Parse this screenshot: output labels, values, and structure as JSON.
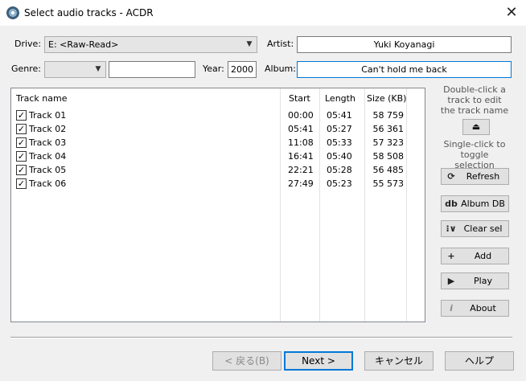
{
  "window": {
    "title": "Select audio tracks - ACDR",
    "close_glyph": "✕"
  },
  "form": {
    "drive_label": "Drive:",
    "drive_value": "E: <Raw-Read>",
    "artist_label": "Artist:",
    "artist_value": "Yuki Koyanagi",
    "genre_label": "Genre:",
    "genre_value": "",
    "genre_text": "",
    "year_label": "Year:",
    "year_value": "2000",
    "album_label": "Album:",
    "album_value": "Can't hold me back"
  },
  "tracks": {
    "columns": [
      "Track name",
      "Start",
      "Length",
      "Size (KB)"
    ],
    "rows": [
      {
        "checked": true,
        "name": "Track 01",
        "start": "00:00",
        "length": "05:41",
        "size": "58 759"
      },
      {
        "checked": true,
        "name": "Track 02",
        "start": "05:41",
        "length": "05:27",
        "size": "56 361"
      },
      {
        "checked": true,
        "name": "Track 03",
        "start": "11:08",
        "length": "05:33",
        "size": "57 323"
      },
      {
        "checked": true,
        "name": "Track 04",
        "start": "16:41",
        "length": "05:40",
        "size": "58 508"
      },
      {
        "checked": true,
        "name": "Track 05",
        "start": "22:21",
        "length": "05:28",
        "size": "56 485"
      },
      {
        "checked": true,
        "name": "Track 06",
        "start": "27:49",
        "length": "05:23",
        "size": "55 573"
      }
    ]
  },
  "side": {
    "hint_edit": "Double-click a track to edit the track name",
    "eject_glyph": "⏏",
    "hint_toggle": "Single-click to toggle selection",
    "refresh_icon": "⟳",
    "refresh": "Refresh",
    "albumdb_icon": "db",
    "albumdb": "Album DB",
    "clearsel_icon": "⁝∨",
    "clearsel": "Clear sel",
    "add_icon": "+",
    "add": "Add",
    "play_icon": "▶",
    "play": "Play",
    "about_icon": "i",
    "about": "About"
  },
  "footer": {
    "back": "< 戻る(B)",
    "next": "Next >",
    "cancel": "キャンセル",
    "help": "ヘルプ"
  }
}
